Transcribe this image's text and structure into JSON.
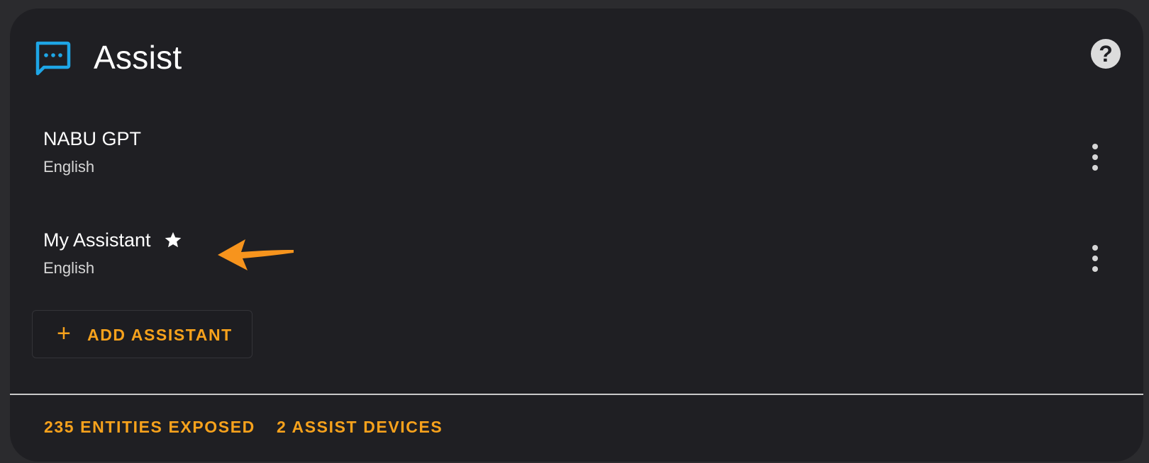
{
  "card": {
    "title": "Assist",
    "title_icon": "message-processing-icon",
    "help_icon": "help-circle-icon"
  },
  "pipelines": [
    {
      "name": "NABU GPT",
      "language": "English",
      "preferred": false,
      "menu_icon": "dots-vertical-icon"
    },
    {
      "name": "My Assistant",
      "language": "English",
      "preferred": true,
      "menu_icon": "dots-vertical-icon"
    }
  ],
  "annotation": {
    "icon": "arrow-left-icon",
    "color": "#f7941d"
  },
  "add_button": {
    "label": "ADD ASSISTANT",
    "icon": "plus-icon"
  },
  "footer": {
    "entities_link": "235 ENTITIES EXPOSED",
    "devices_link": "2 ASSIST DEVICES"
  },
  "colors": {
    "accent": "#f7a21c",
    "icon_blue": "#1ea6e6",
    "card_bg": "#1f1f23",
    "page_bg": "#2b2b2e"
  }
}
